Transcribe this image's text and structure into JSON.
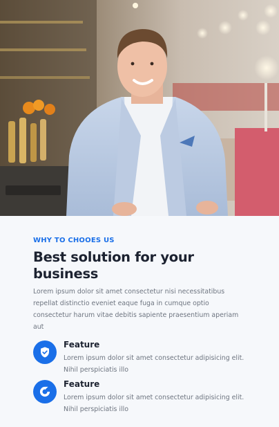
{
  "hero": {
    "image": "portrait-in-restaurant"
  },
  "section": {
    "eyebrow": "WHY TO CHOOES US",
    "title": "Best solution for your business",
    "description": "Lorem ipsum dolor sit amet consectetur nisi necessitatibus repellat distinctio eveniet eaque fuga in cumque optio consectetur harum vitae debitis sapiente praesentium aperiam aut"
  },
  "features": [
    {
      "icon": "shield-check-icon",
      "title": "Feature",
      "description": "Lorem ipsum dolor sit amet consectetur adipisicing elit. Nihil perspiciatis illo"
    },
    {
      "icon": "refresh-icon",
      "title": "Feature",
      "description": "Lorem ipsum dolor sit amet consectetur adipisicing elit. Nihil perspiciatis illo"
    }
  ],
  "colors": {
    "accent": "#1a6fe8",
    "heading": "#1c2230",
    "body_text": "#6e7580",
    "background": "#f6f8fb"
  }
}
